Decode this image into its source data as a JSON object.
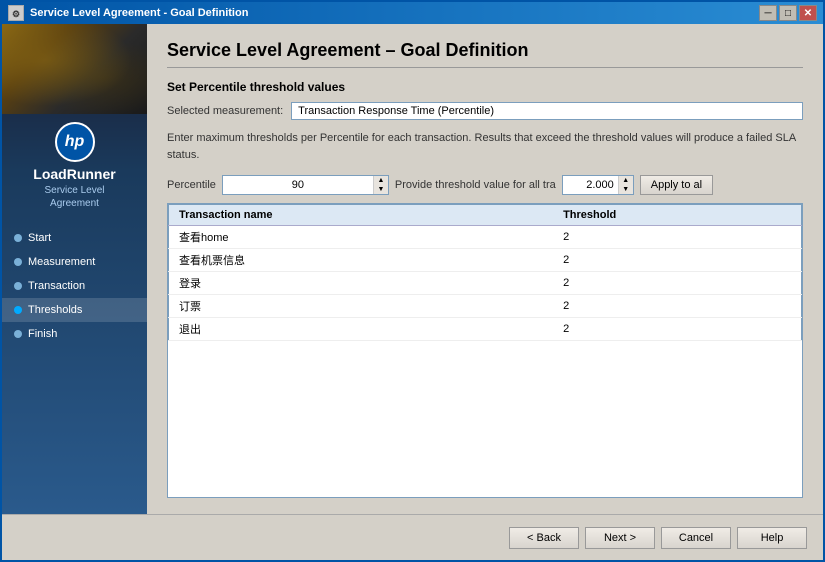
{
  "window": {
    "title": "Service Level Agreement - Goal Definition",
    "close_btn": "✕",
    "minimize_btn": "─",
    "maximize_btn": "□"
  },
  "sidebar": {
    "brand": "LoadRunner",
    "subtitle_line1": "Service Level",
    "subtitle_line2": "Agreement",
    "hp_logo": "hp",
    "nav_items": [
      {
        "id": "start",
        "label": "Start",
        "active": false
      },
      {
        "id": "measurement",
        "label": "Measurement",
        "active": false
      },
      {
        "id": "transaction",
        "label": "Transaction",
        "active": false
      },
      {
        "id": "thresholds",
        "label": "Thresholds",
        "active": true
      },
      {
        "id": "finish",
        "label": "Finish",
        "active": false
      }
    ]
  },
  "main": {
    "page_title": "Service Level Agreement – Goal Definition",
    "section_title": "Set Percentile threshold values",
    "measurement_label": "Selected measurement:",
    "measurement_value": "Transaction Response Time (Percentile)",
    "description": "Enter maximum thresholds per Percentile for each transaction. Results that exceed the threshold values will produce a failed SLA status.",
    "percentile_label": "Percentile",
    "percentile_value": "90",
    "threshold_label": "Provide threshold value for all tra",
    "threshold_value": "2.000",
    "apply_label": "Apply to al",
    "table": {
      "columns": [
        {
          "id": "transaction_name",
          "label": "Transaction name"
        },
        {
          "id": "threshold",
          "label": "Threshold"
        }
      ],
      "rows": [
        {
          "transaction_name": "查看home",
          "threshold": "2"
        },
        {
          "transaction_name": "查看机票信息",
          "threshold": "2"
        },
        {
          "transaction_name": "登录",
          "threshold": "2"
        },
        {
          "transaction_name": "订票",
          "threshold": "2"
        },
        {
          "transaction_name": "退出",
          "threshold": "2"
        }
      ]
    }
  },
  "footer": {
    "back_label": "< Back",
    "next_label": "Next >",
    "cancel_label": "Cancel",
    "help_label": "Help"
  }
}
